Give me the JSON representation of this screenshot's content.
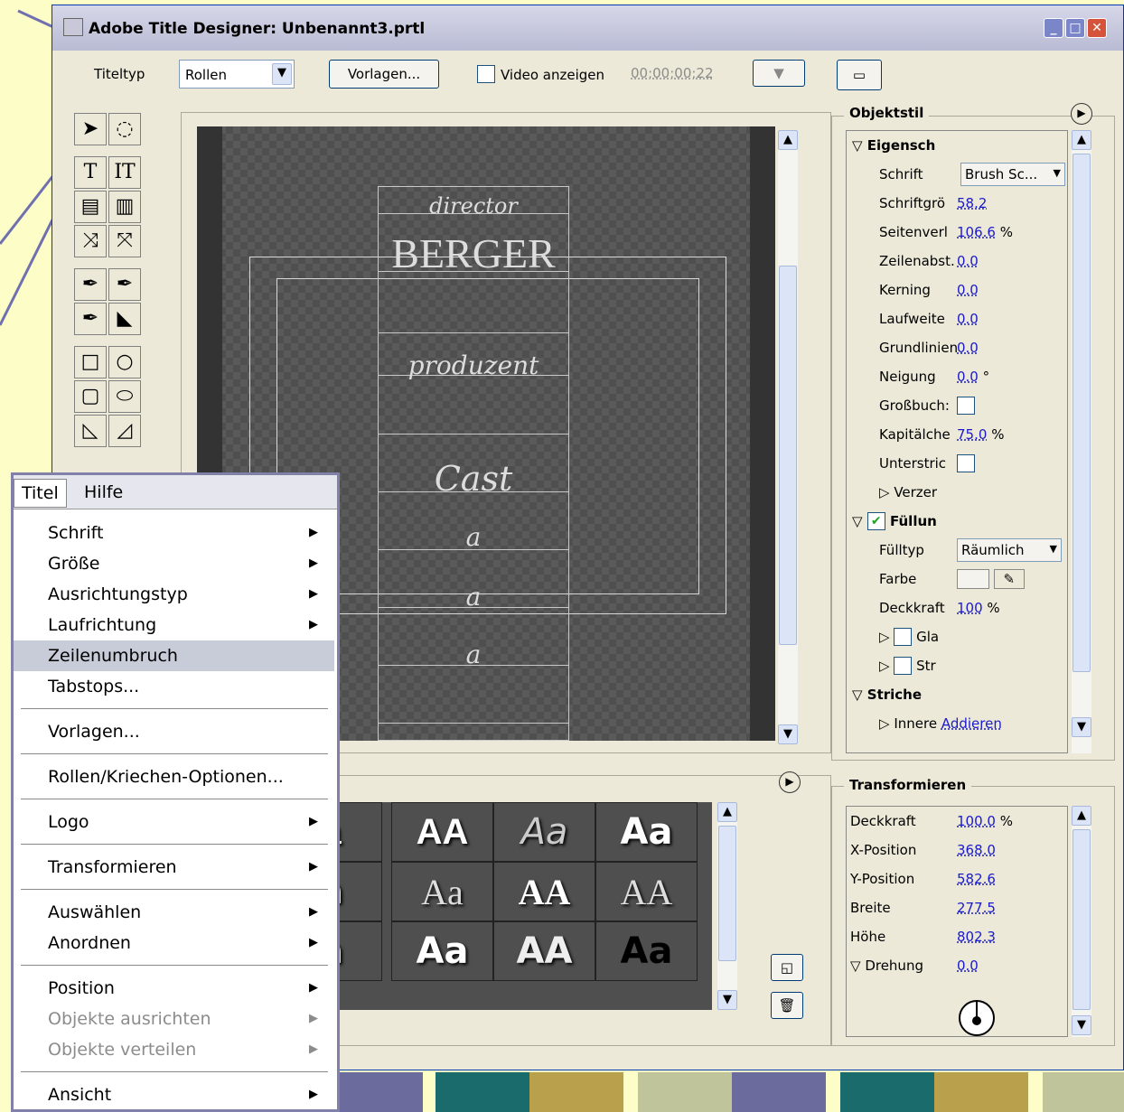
{
  "window": {
    "title": "Adobe Title Designer: Unbenannt3.prtl"
  },
  "toolbar": {
    "titletype_label": "Titeltyp",
    "titletype_value": "Rollen",
    "templates_button": "Vorlagen...",
    "show_video_label": "Video anzeigen",
    "timecode": "00;00;00;22"
  },
  "canvas_text": {
    "director": "director",
    "berger": "BERGER",
    "produzent": "produzent",
    "cast": "Cast",
    "a1": "a",
    "a2": "a",
    "a3": "a"
  },
  "object_style": {
    "title": "Objektstil",
    "properties_header": "Eigensch",
    "rows": [
      {
        "label": "Schrift",
        "value": "Brush Sc...",
        "unit": ""
      },
      {
        "label": "Schriftgrö",
        "value": "58.2",
        "unit": ""
      },
      {
        "label": "Seitenverl",
        "value": "106.6",
        "unit": "%"
      },
      {
        "label": "Zeilenabst.",
        "value": "0.0",
        "unit": ""
      },
      {
        "label": "Kerning",
        "value": "0.0",
        "unit": ""
      },
      {
        "label": "Laufweite",
        "value": "0.0",
        "unit": ""
      },
      {
        "label": "Grundlinien",
        "value": "0.0",
        "unit": ""
      },
      {
        "label": "Neigung",
        "value": "0.0",
        "unit": "°"
      },
      {
        "label": "Großbuch:",
        "value": "",
        "unit": ""
      },
      {
        "label": "Kapitälche",
        "value": "75.0",
        "unit": "%"
      },
      {
        "label": "Unterstric",
        "value": "",
        "unit": ""
      }
    ],
    "distort_label": "Verzer",
    "fill_header": "Füllun",
    "fill_type_label": "Fülltyp",
    "fill_type_value": "Räumlich",
    "color_label": "Farbe",
    "opacity_label": "Deckkraft",
    "opacity_value": "100",
    "opacity_unit": "%",
    "gloss_label": "Gla",
    "texture_label": "Str",
    "strokes_header": "Striche",
    "inner_label": "Innere",
    "add_label": "Addieren"
  },
  "transform": {
    "title": "Transformieren",
    "rows": [
      {
        "label": "Deckkraft",
        "value": "100.0",
        "unit": "%"
      },
      {
        "label": "X-Position",
        "value": "368.0",
        "unit": ""
      },
      {
        "label": "Y-Position",
        "value": "582.6",
        "unit": ""
      },
      {
        "label": "Breite",
        "value": "277.5",
        "unit": ""
      },
      {
        "label": "Höhe",
        "value": "802.3",
        "unit": ""
      }
    ],
    "rotation_label": "Drehung",
    "rotation_value": "0.0"
  },
  "styles_grid": [
    "a",
    "AA",
    "Aa",
    "Aa",
    "a",
    "Aa",
    "AA",
    "AA",
    "a",
    "Aa",
    "AA",
    "Aa"
  ],
  "menu": {
    "bar": [
      "Titel",
      "Hilfe"
    ],
    "items": [
      "Schrift",
      "Größe",
      "Ausrichtungstyp",
      "Laufrichtung",
      "Zeilenumbruch",
      "Tabstops...",
      "Vorlagen...",
      "Rollen/Kriechen-Optionen...",
      "Logo",
      "Transformieren",
      "Auswählen",
      "Anordnen",
      "Position",
      "Objekte ausrichten",
      "Objekte verteilen",
      "Ansicht"
    ]
  },
  "colors": {
    "window_bg": "#ece9d8",
    "page_bg": "#fdfdc8",
    "arrow": "#7070b0",
    "link": "#1a1acd",
    "menu_highlight": "#c8ccd8"
  }
}
